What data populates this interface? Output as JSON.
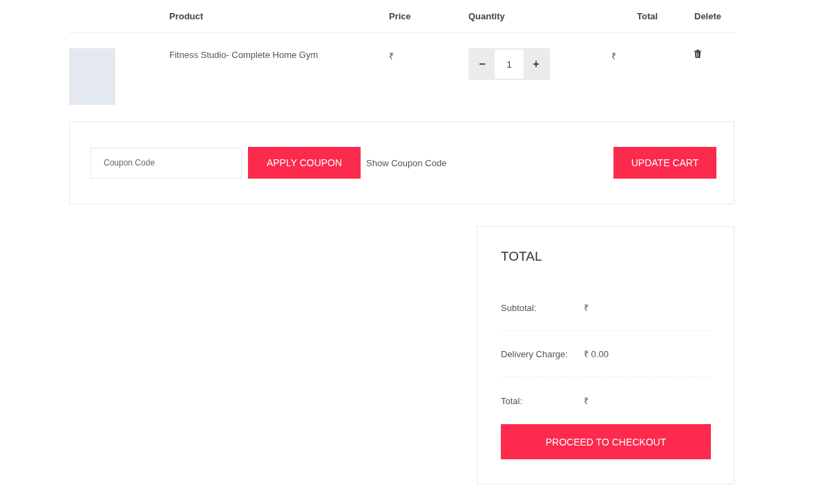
{
  "table": {
    "columns": [
      "Product",
      "Price",
      "Quantity",
      "Total",
      "Delete"
    ],
    "rows": [
      {
        "product": "Fitness Studio- Complete Home Gym",
        "price": "₹",
        "decrement": "−",
        "quantity": "1",
        "increment": "+",
        "total": "₹"
      }
    ]
  },
  "coupon": {
    "placeholder": "Coupon Code",
    "apply_button": "APPLY COUPON",
    "show_link": "Show Coupon Code",
    "update_button": "UPDATE CART"
  },
  "totals": {
    "title": "TOTAL",
    "rows": [
      {
        "label": "Subtotal:",
        "value": "₹"
      },
      {
        "label": "Delivery Charge:",
        "value": "₹ 0.00"
      },
      {
        "label": "Total:",
        "value": "₹"
      }
    ],
    "checkout_button": "PROCEED TO CHECKOUT"
  }
}
